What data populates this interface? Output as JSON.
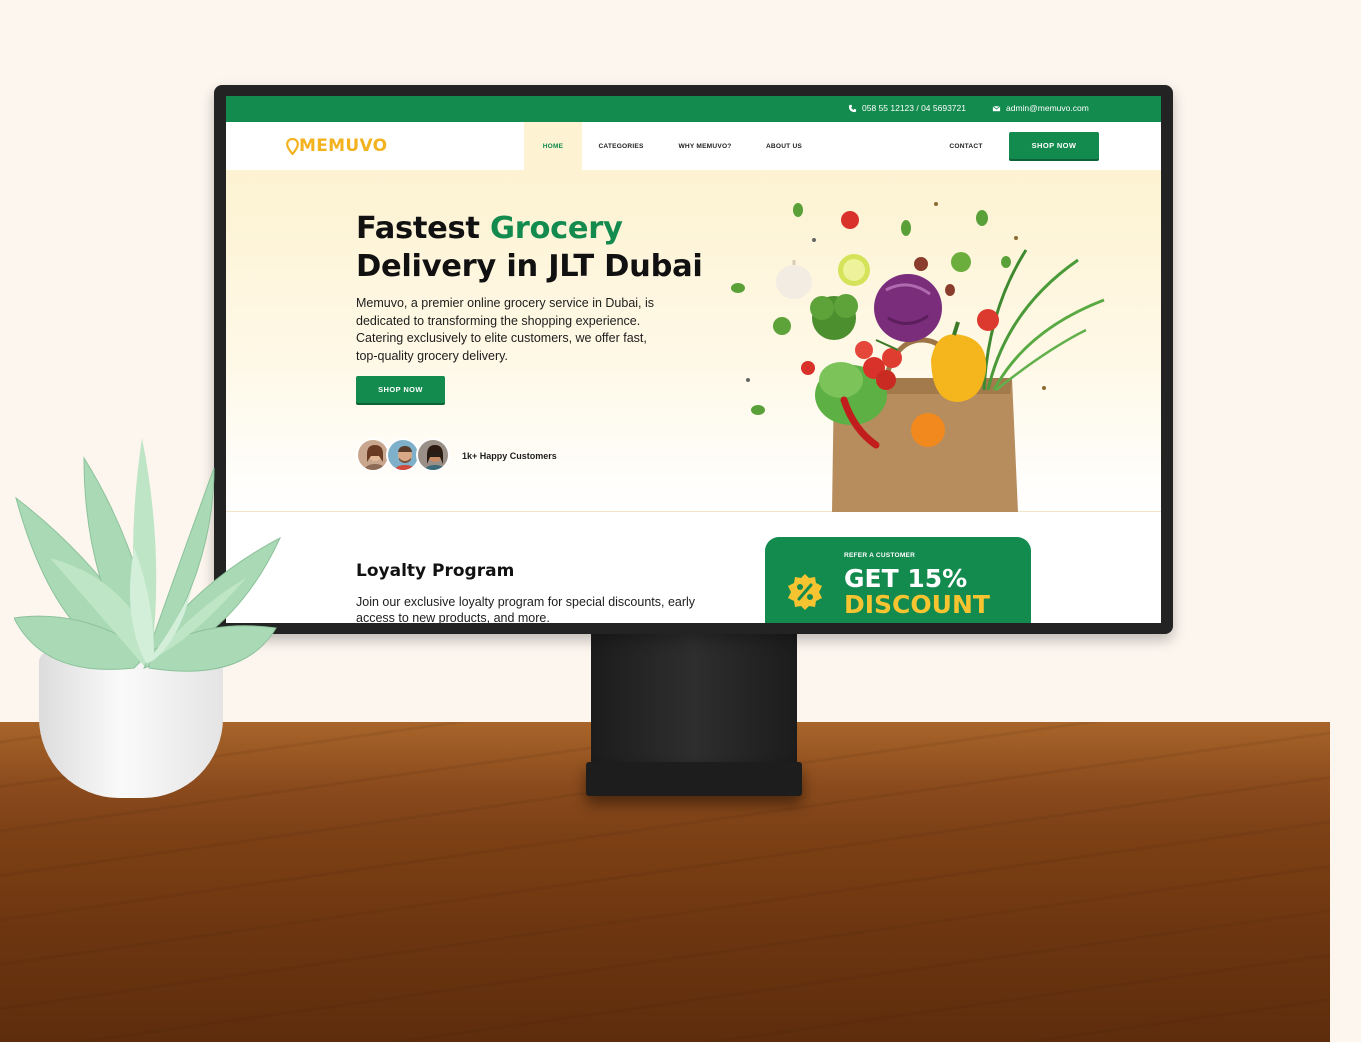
{
  "topbar": {
    "phone": "058 55 12123 / 04 5693721",
    "email": "admin@memuvo.com"
  },
  "brand": {
    "logo": "MEMUVO"
  },
  "nav": {
    "items": [
      {
        "label": "HOME",
        "active": true
      },
      {
        "label": "CATEGORIES",
        "active": false
      },
      {
        "label": "WHY MEMUVO?",
        "active": false
      },
      {
        "label": "ABOUT US",
        "active": false
      },
      {
        "label": "CONTACT",
        "active": false
      }
    ],
    "shop_label": "SHOP NOW"
  },
  "hero": {
    "title_part1": "Fastest ",
    "title_highlight": "Grocery",
    "title_line2": "Delivery in JLT Dubai",
    "description": "Memuvo, a premier online grocery service in Dubai, is dedicated to transforming the shopping experience. Catering exclusively to elite customers, we offer fast, top-quality grocery delivery.",
    "cta_label": "SHOP NOW",
    "customers_label": "1k+ Happy Customers"
  },
  "loyalty": {
    "title": "Loyalty Program",
    "text": "Join our exclusive loyalty program for special discounts, early access to new products, and more."
  },
  "promo": {
    "kicker": "REFER A CUSTOMER",
    "line1": "GET 15%",
    "line2": "DISCOUNT"
  },
  "colors": {
    "brand_green": "#138a4e",
    "brand_yellow": "#f3b21f",
    "hero_bg": "#fdf3d2"
  },
  "icons": [
    "phone-icon",
    "mail-icon",
    "location-pin-icon",
    "discount-badge-icon"
  ]
}
